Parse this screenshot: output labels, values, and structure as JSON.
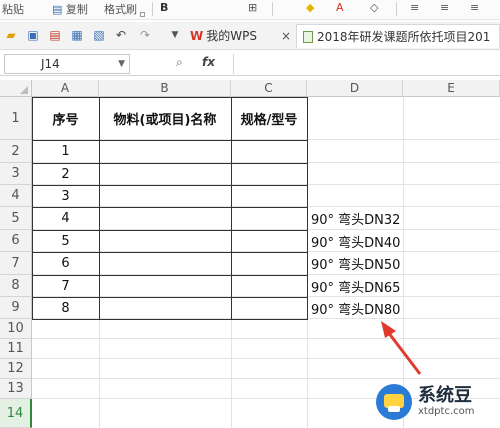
{
  "ribbon": {
    "paste_label": "粘贴",
    "copy_label": "复制",
    "format_painter_label": "格式刷"
  },
  "toolbar": {
    "wps_tab_label": "我的WPS",
    "close_label": "×",
    "document_tab_label": "2018年研发课题所依托项目201"
  },
  "formula_bar": {
    "cell_reference": "J14",
    "fx_label": "fx"
  },
  "columns": [
    "A",
    "B",
    "C",
    "D",
    "E"
  ],
  "rows": [
    "1",
    "2",
    "3",
    "4",
    "5",
    "6",
    "7",
    "8",
    "9",
    "10",
    "11",
    "12",
    "13",
    "14"
  ],
  "selected_row": "14",
  "table": {
    "headers": [
      "序号",
      "物料(或项目)名称",
      "规格/型号"
    ],
    "serial_numbers": [
      "1",
      "2",
      "3",
      "4",
      "5",
      "6",
      "7",
      "8"
    ],
    "column_d_values": [
      "90° 弯头DN32",
      "90° 弯头DN40",
      "90° 弯头DN50",
      "90° 弯头DN65",
      "90° 弯头DN80"
    ]
  },
  "watermark": {
    "title": "系统豆",
    "subtitle": "xtdptc.com"
  },
  "colors": {
    "selection_green": "#2f8a3a",
    "annotation_red": "#e03a2f",
    "watermark_blue": "#2a7bd6"
  }
}
